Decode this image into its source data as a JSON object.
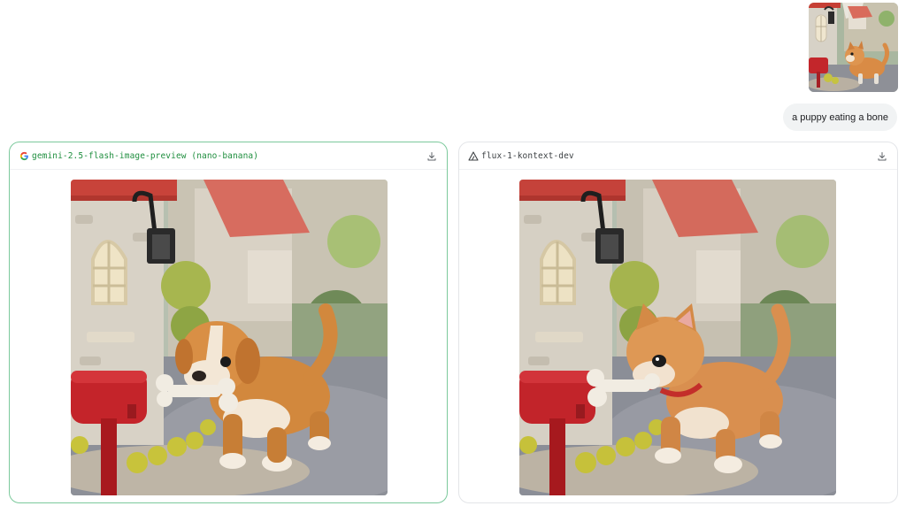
{
  "user_message": {
    "attachment_alt": "felt kitten with a red mailbox and stone house",
    "prompt_text": "a puppy eating a bone"
  },
  "results": [
    {
      "model_name": "gemini-2.5-flash-image-preview (nano-banana)",
      "provider_icon": "google-g-icon",
      "image_subject": "felt puppy holding a bone beside a red mailbox",
      "download_icon": "download-icon",
      "accent_color": "#1e8e3e",
      "border_color": "#7cc99c"
    },
    {
      "model_name": "flux-1-kontext-dev",
      "provider_icon": "triangle-logo-icon",
      "image_subject": "felt kitten biting a bone beside a red mailbox",
      "download_icon": "download-icon",
      "accent_color": "#3c4043",
      "border_color": "#e3e5e8"
    }
  ]
}
